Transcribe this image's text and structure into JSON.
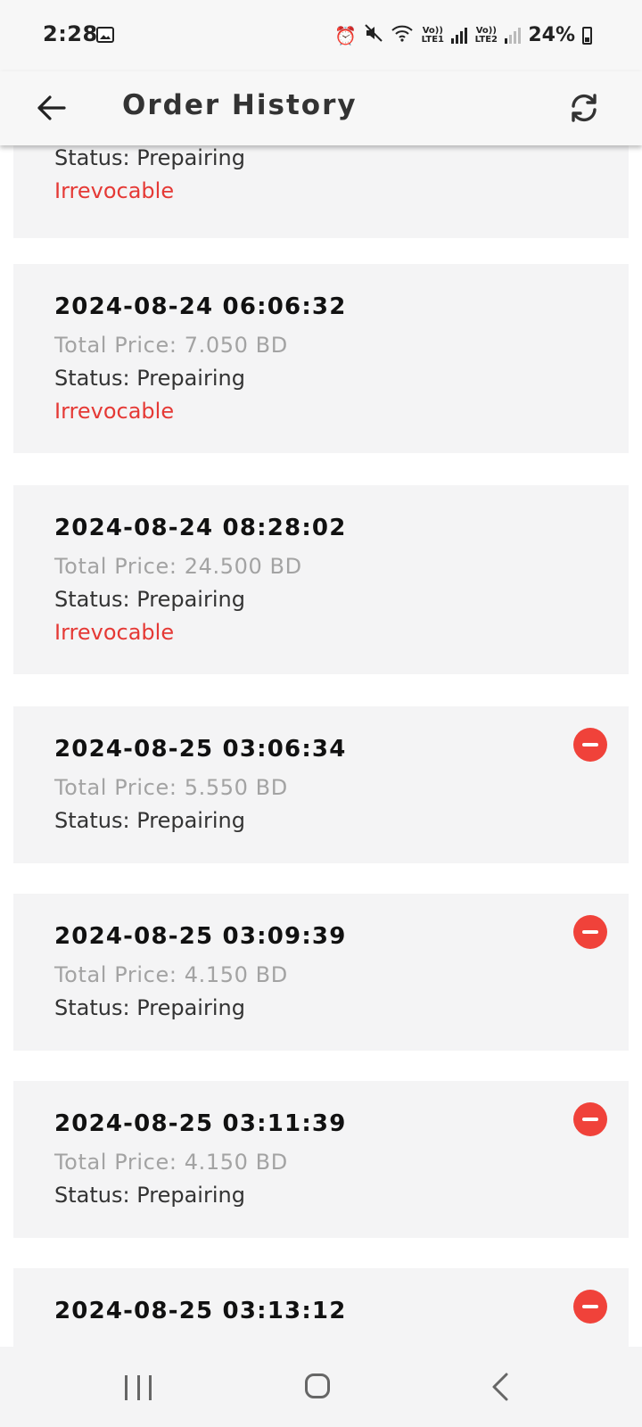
{
  "status_bar": {
    "time": "2:28",
    "lte1": "Vo)) LTE1",
    "lte2": "Vo)) LTE2",
    "battery": "24%"
  },
  "app_bar": {
    "title": "Order History"
  },
  "orders": [
    {
      "date": "",
      "price": "",
      "status": "Status: Prepairing",
      "note": "Irrevocable",
      "cancelable": false
    },
    {
      "date": "2024-08-24 06:06:32",
      "price": "Total Price: 7.050 BD",
      "status": "Status: Prepairing",
      "note": "Irrevocable",
      "cancelable": false
    },
    {
      "date": "2024-08-24 08:28:02",
      "price": "Total Price: 24.500 BD",
      "status": "Status: Prepairing",
      "note": "Irrevocable",
      "cancelable": false
    },
    {
      "date": "2024-08-25 03:06:34",
      "price": "Total Price: 5.550 BD",
      "status": "Status: Prepairing",
      "note": "",
      "cancelable": true
    },
    {
      "date": "2024-08-25 03:09:39",
      "price": "Total Price: 4.150 BD",
      "status": "Status: Prepairing",
      "note": "",
      "cancelable": true
    },
    {
      "date": "2024-08-25 03:11:39",
      "price": "Total Price: 4.150 BD",
      "status": "Status: Prepairing",
      "note": "",
      "cancelable": true
    },
    {
      "date": "2024-08-25 03:13:12",
      "price": "",
      "status": "",
      "note": "",
      "cancelable": true
    }
  ],
  "colors": {
    "accent_red": "#e53935",
    "cancel_red": "#f0423a",
    "card_bg": "#f4f4f5"
  }
}
